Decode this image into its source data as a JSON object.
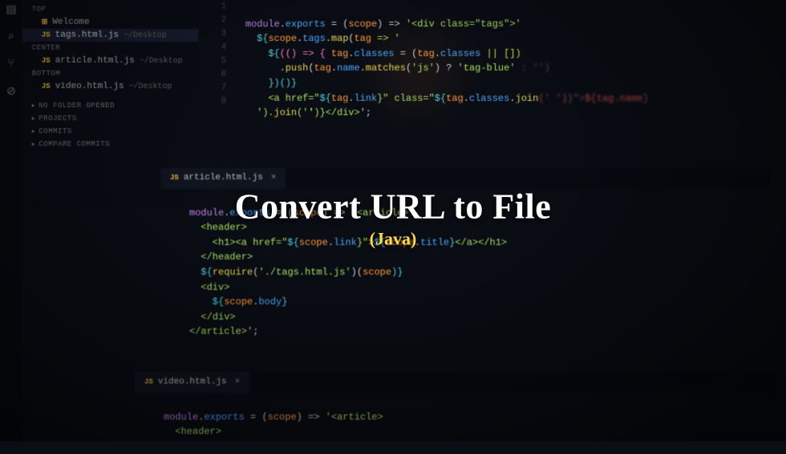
{
  "overlay": {
    "title": "Convert URL to File",
    "subtitle": "(Java)"
  },
  "explorer": {
    "sections": {
      "top": "TOP",
      "center": "CENTER",
      "bottom": "BOTTOM"
    },
    "items": {
      "welcome": "Welcome",
      "tags": "tags.html.js",
      "tags_path": "~/Desktop",
      "article": "article.html.js",
      "article_path": "~/Desktop",
      "video": "video.html.js",
      "video_path": "~/Desktop"
    },
    "folders": {
      "no_folder": "NO FOLDER OPENED",
      "projects": "PROJECTS",
      "commits": "COMMITS",
      "compare": "COMPARE COMMITS"
    }
  },
  "tabs": {
    "article": "article.html.js",
    "video": "video.html.js"
  },
  "icons": {
    "js": "JS",
    "close": "×",
    "caret": "▸",
    "vscode": "⊞",
    "search": "⌕",
    "git": "⑂",
    "debug": "⊘"
  },
  "code_top": {
    "l1_a": "module",
    "l1_b": ".",
    "l1_c": "exports",
    "l1_d": " = (",
    "l1_e": "scope",
    "l1_f": ") => ",
    "l1_g": "'<div class=\"tags\">'",
    "l2_a": "${",
    "l2_b": "scope",
    "l2_c": ".",
    "l2_d": "tags",
    "l2_e": ".",
    "l2_f": "map",
    "l2_g": "(",
    "l2_h": "tag",
    "l2_i": " => '",
    "l3_a": "${",
    "l3_b": "(() => { ",
    "l3_c": "tag",
    "l3_d": ".",
    "l3_e": "classes",
    "l3_f": " = (",
    "l3_g": "tag",
    "l3_h": ".",
    "l3_i": "classes",
    "l3_j": " || [])",
    "l4_a": ".",
    "l4_b": "push",
    "l4_c": "(",
    "l4_d": "tag",
    "l4_e": ".",
    "l4_f": "name",
    "l4_g": ".",
    "l4_h": "matches",
    "l4_i": "(",
    "l4_j": "'js'",
    "l4_k": ") ? ",
    "l4_l": "'tag-blue'",
    "l4_m": " : '')",
    "l5_a": "})()}",
    "l6_a": "<a href=\"",
    "l6_b": "${",
    "l6_c": "tag",
    "l6_d": ".",
    "l6_e": "link",
    "l6_f": "}\" class=\"",
    "l6_g": "${",
    "l6_h": "tag",
    "l6_i": ".",
    "l6_j": "classes",
    "l6_k": ".",
    "l6_l": "join",
    "l6_m": "(' ')",
    "l6_n": "}\">",
    "l6_o": "${",
    "l6_p": "tag.name",
    "l6_q": "}",
    "l7_a": "').",
    "l7_b": "join",
    "l7_c": "('')}",
    "l7_d": "</div>",
    "l7_e": "';"
  },
  "code_mid": {
    "l1_a": "module",
    "l1_b": ".",
    "l1_c": "exports",
    "l1_d": " = (",
    "l1_e": "scope",
    "l1_f": ") => ",
    "l1_g": "'<article>",
    "l2_a": "  <header>",
    "l3_a": "    <h1><a href=\"",
    "l3_b": "${",
    "l3_c": "scope",
    "l3_d": ".",
    "l3_e": "link",
    "l3_f": "}\">",
    "l3_g": "${",
    "l3_h": "scope",
    "l3_i": ".",
    "l3_j": "title",
    "l3_k": "}",
    "l3_l": "</a></h1>",
    "l4_a": "  </header>",
    "l5_a": "  ${",
    "l5_b": "require",
    "l5_c": "(",
    "l5_d": "'./tags.html.js'",
    "l5_e": ")(",
    "l5_f": "scope",
    "l5_g": ")}",
    "l6_a": "  <div>",
    "l7_a": "    ${",
    "l7_b": "scope",
    "l7_c": ".",
    "l7_d": "body",
    "l7_e": "}",
    "l8_a": "  </div>",
    "l9_a": "</article>",
    "l9_b": "';"
  },
  "code_bot": {
    "l1_a": "module",
    "l1_b": ".",
    "l1_c": "exports",
    "l1_d": " = (",
    "l1_e": "scope",
    "l1_f": ") => ",
    "l1_g": "'<article>",
    "l2_a": "  <header>"
  },
  "line_nums_top": [
    "1",
    "2",
    "3",
    "4",
    "5",
    "6",
    "7",
    "8"
  ],
  "line_nums_mid": [
    "",
    "",
    "",
    "",
    "",
    "",
    "",
    "",
    ""
  ]
}
